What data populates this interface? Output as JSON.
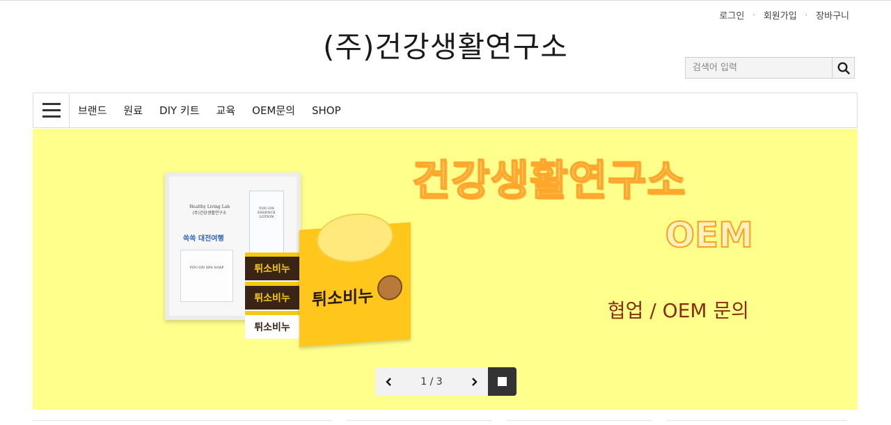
{
  "header": {
    "logo_text": "(주)건강생활연구소",
    "links": [
      "로그인",
      "회원가입",
      "장바구니"
    ],
    "separator": "·"
  },
  "search": {
    "placeholder": "검색어 입력",
    "icon": "search-icon"
  },
  "nav": {
    "menu_icon": "hamburger-icon",
    "items": [
      "브랜드",
      "원료",
      "DIY 키트",
      "교육",
      "OEM문의",
      "SHOP"
    ]
  },
  "banner": {
    "background": "#ffff8c",
    "title": "건강생활연구소",
    "oem": "OEM",
    "subtitle": "협업 / OEM 문의",
    "product_texts": {
      "box_brand": "Healthy Living Lab",
      "box_brand_kr": "(주)건강생활연구소",
      "box_line": "쏙쏙 대전여행",
      "lotion": "YOU-ON ESSENCE LOTION",
      "spa_soap": "YOU-ON SPA SOAP",
      "soap_name": "튀소비누"
    }
  },
  "slider": {
    "current": 1,
    "total": 3,
    "counter": "1 / 3",
    "prev_icon": "chevron-left-icon",
    "next_icon": "chevron-right-icon",
    "stop_icon": "stop-icon"
  }
}
